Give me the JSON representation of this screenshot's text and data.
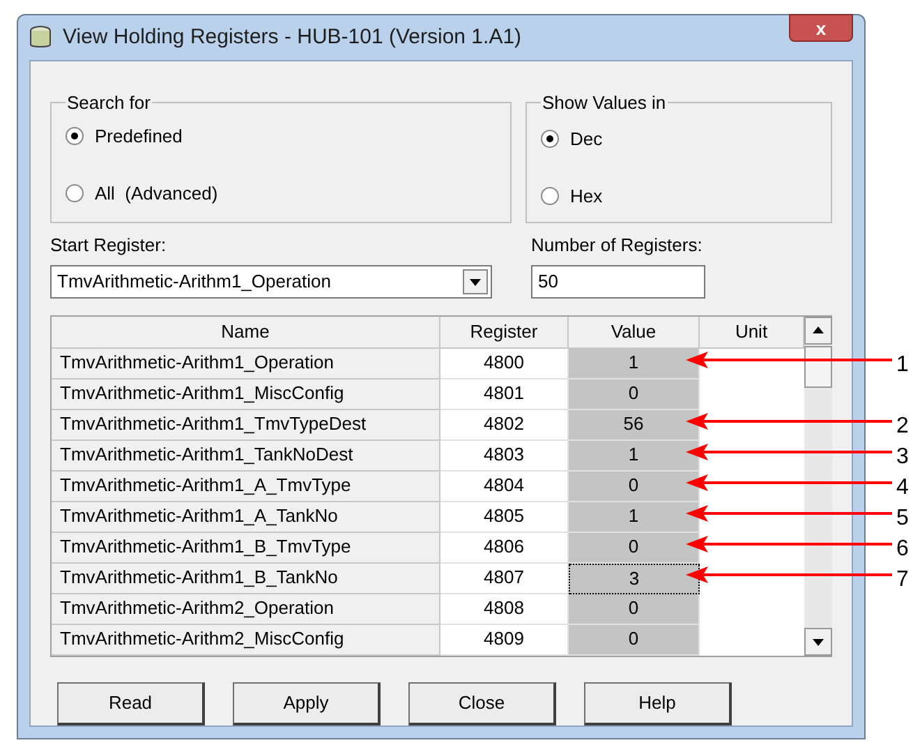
{
  "window": {
    "title": "View Holding Registers - HUB-101 (Version 1.A1)",
    "close": "x"
  },
  "search_for": {
    "label": "Search for",
    "options": [
      {
        "label": "Predefined",
        "selected": true
      },
      {
        "label": "All  (Advanced)",
        "selected": false
      }
    ]
  },
  "show_values_in": {
    "label": "Show Values in",
    "options": [
      {
        "label": "Dec",
        "selected": true
      },
      {
        "label": "Hex",
        "selected": false
      }
    ]
  },
  "start_register": {
    "label": "Start Register:",
    "value": "TmvArithmetic-Arithm1_Operation"
  },
  "number_of_registers": {
    "label": "Number of Registers:",
    "value": "50"
  },
  "table": {
    "columns": [
      "Name",
      "Register",
      "Value",
      "Unit"
    ],
    "rows": [
      {
        "name": "TmvArithmetic-Arithm1_Operation",
        "register": "4800",
        "value": "1",
        "focused": false,
        "annotation": "1"
      },
      {
        "name": "TmvArithmetic-Arithm1_MiscConfig",
        "register": "4801",
        "value": "0",
        "focused": false
      },
      {
        "name": "TmvArithmetic-Arithm1_TmvTypeDest",
        "register": "4802",
        "value": "56",
        "focused": false,
        "annotation": "2"
      },
      {
        "name": "TmvArithmetic-Arithm1_TankNoDest",
        "register": "4803",
        "value": "1",
        "focused": false,
        "annotation": "3"
      },
      {
        "name": "TmvArithmetic-Arithm1_A_TmvType",
        "register": "4804",
        "value": "0",
        "focused": false,
        "annotation": "4"
      },
      {
        "name": "TmvArithmetic-Arithm1_A_TankNo",
        "register": "4805",
        "value": "1",
        "focused": false,
        "annotation": "5"
      },
      {
        "name": "TmvArithmetic-Arithm1_B_TmvType",
        "register": "4806",
        "value": "0",
        "focused": false,
        "annotation": "6"
      },
      {
        "name": "TmvArithmetic-Arithm1_B_TankNo",
        "register": "4807",
        "value": "3",
        "focused": true,
        "annotation": "7"
      },
      {
        "name": "TmvArithmetic-Arithm2_Operation",
        "register": "4808",
        "value": "0",
        "focused": false
      },
      {
        "name": "TmvArithmetic-Arithm2_MiscConfig",
        "register": "4809",
        "value": "0",
        "focused": false
      }
    ]
  },
  "buttons": [
    "Read",
    "Apply",
    "Close",
    "Help"
  ]
}
